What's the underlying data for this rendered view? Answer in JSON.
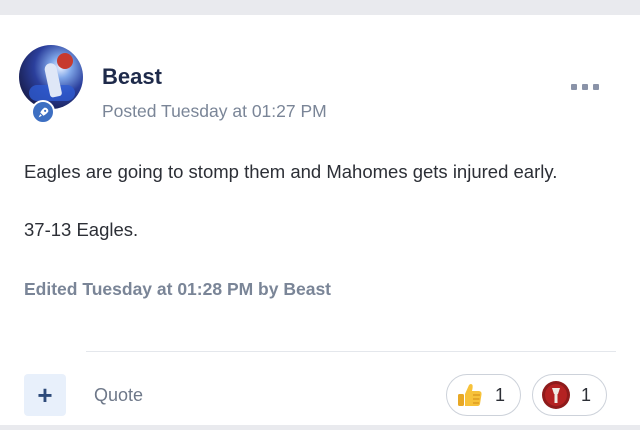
{
  "post": {
    "author": "Beast",
    "posted": "Posted Tuesday at 01:27 PM",
    "content": {
      "line1": "Eagles are going to stomp them and Mahomes gets injured early.",
      "line2": "37-13 Eagles."
    },
    "edited": "Edited Tuesday at 01:28 PM by Beast"
  },
  "actions": {
    "add_label": "+",
    "quote_label": "Quote"
  },
  "reactions": [
    {
      "icon": "thumbs-up-icon",
      "count": "1"
    },
    {
      "icon": "red-badge-icon",
      "count": "1"
    }
  ],
  "colors": {
    "accent": "#3d6fc2",
    "author": "#1e2a4a",
    "meta": "#7a8597"
  }
}
